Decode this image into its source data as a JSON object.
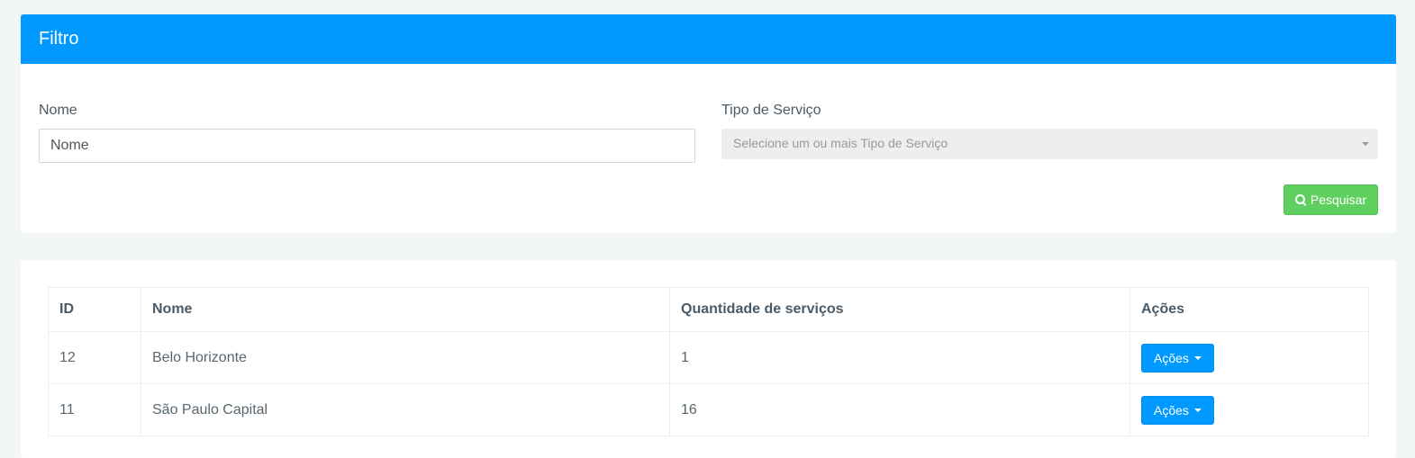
{
  "filter": {
    "title": "Filtro",
    "name_label": "Nome",
    "name_placeholder": "Nome",
    "service_type_label": "Tipo de Serviço",
    "service_type_placeholder": "Selecione um ou mais Tipo de Serviço",
    "search_button": "Pesquisar"
  },
  "table": {
    "headers": [
      "ID",
      "Nome",
      "Quantidade de serviços",
      "Ações"
    ],
    "rows": [
      {
        "id": "12",
        "nome": "Belo Horizonte",
        "quantidade": "1",
        "acoes": "Ações"
      },
      {
        "id": "11",
        "nome": "São Paulo Capital",
        "quantidade": "16",
        "acoes": "Ações"
      }
    ]
  },
  "colors": {
    "primary": "#0099ff",
    "success": "#5fcf5f",
    "background": "#f2f6f6"
  }
}
